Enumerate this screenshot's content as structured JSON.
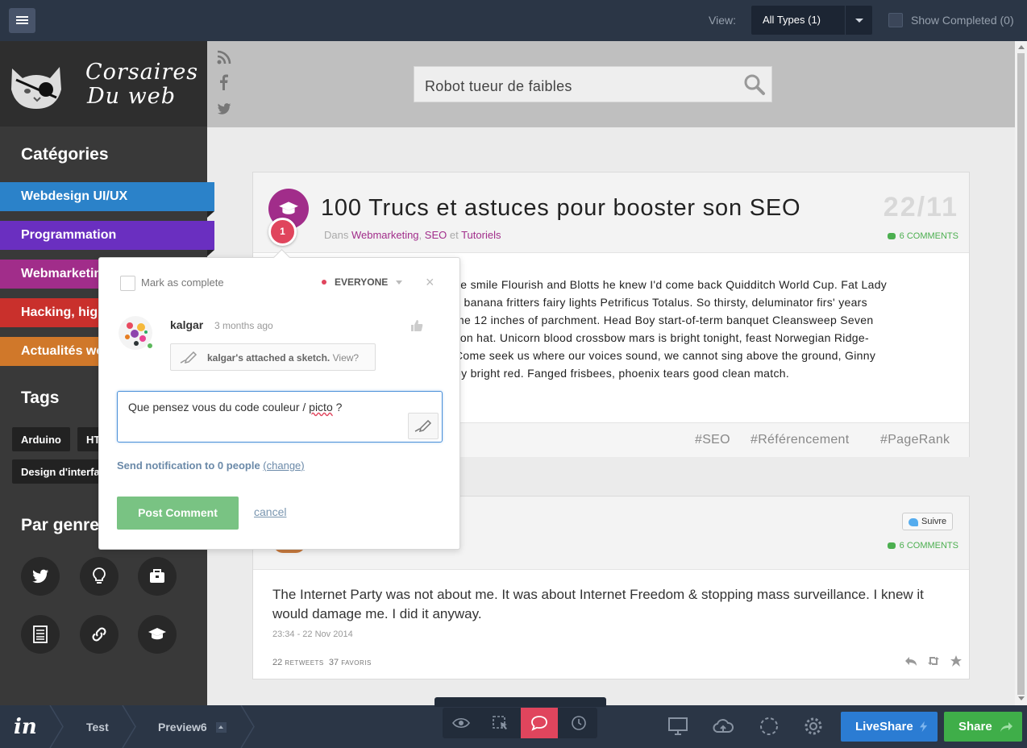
{
  "topbar": {
    "view_label": "View:",
    "view_value": "All Types (1)",
    "show_completed": "Show Completed (0)"
  },
  "sidebar": {
    "logo_line1": "Corsaires",
    "logo_line2": "Du web",
    "categories_title": "Catégories",
    "categories": [
      {
        "label": "Webdesign UI/UX",
        "color": "#2b82c9"
      },
      {
        "label": "Programmation",
        "color": "#6a2fc0"
      },
      {
        "label": "Webmarketing",
        "color": "#a12d8a"
      },
      {
        "label": "Hacking, high",
        "color": "#c9302c"
      },
      {
        "label": "Actualités web",
        "color": "#d0782a"
      }
    ],
    "tags_title": "Tags",
    "tags": [
      "Arduino",
      "HTML",
      "Design d'interface"
    ],
    "genre_title": "Par genre",
    "genres": [
      "twitter-icon",
      "lightbulb-icon",
      "toolbox-icon",
      "document-icon",
      "link-icon",
      "graduation-cap-icon"
    ]
  },
  "search": {
    "value": "Robot tueur de faibles"
  },
  "post": {
    "title": "100 Trucs et astuces pour booster son SEO",
    "date": "22/11",
    "meta_prefix": "Dans ",
    "cat1": "Webmarketing",
    "sep1": ", ",
    "cat2": "SEO",
    "sep2": " et ",
    "cat3": "Tutoriels",
    "comments": "6 COMMENTS",
    "body": [
      "ke smile Flourish and Blotts he knew I'd come back Quidditch World Cup. Fat Lady",
      "s banana fritters fairy lights Petrificus Totalus. So thirsty, deluminator firs' years",
      "me 12 inches of parchment. Head Boy start-of-term banquet Cleansweep Seven",
      " lion hat. Unicorn blood crossbow mars is bright tonight, feast Norwegian Ridge-",
      "Come seek us where our voices sound, we cannot sing above the ground, Ginny",
      "ey bright red. Fanged frisbees, phoenix tears good clean match."
    ],
    "hashtags": [
      "#SEO",
      "#Référencement",
      "#PageRank"
    ]
  },
  "tweet": {
    "follow": "Suivre",
    "comments": "6 COMMENTS",
    "text": "The Internet Party was not about me. It was about Internet Freedom & stopping mass surveillance. I knew it would damage me. I did it anyway.",
    "time": "23:34 - 22 Nov 2014",
    "retweets_count": "22",
    "retweets_label": "RETWEETS",
    "favorites_count": "37",
    "favorites_label": "FAVORIS"
  },
  "pin": {
    "number": "1"
  },
  "popup": {
    "mark_complete": "Mark as complete",
    "audience": "EVERYONE",
    "close": "×",
    "author": "kalgar",
    "time": "3 months ago",
    "sketch_text": "kalgar's attached a sketch.",
    "sketch_view": "View?",
    "reply_before": "Que pensez vous du code couleur / ",
    "reply_misspelled": "picto",
    "reply_after": " ?",
    "notify_text": "Send notification to 0 people ",
    "notify_change": "(change)",
    "post_button": "Post Comment",
    "cancel": "cancel"
  },
  "bottombar": {
    "logo": "in",
    "crumbs": [
      "Test",
      "Preview6"
    ],
    "liveshare": "LiveShare",
    "share": "Share"
  }
}
